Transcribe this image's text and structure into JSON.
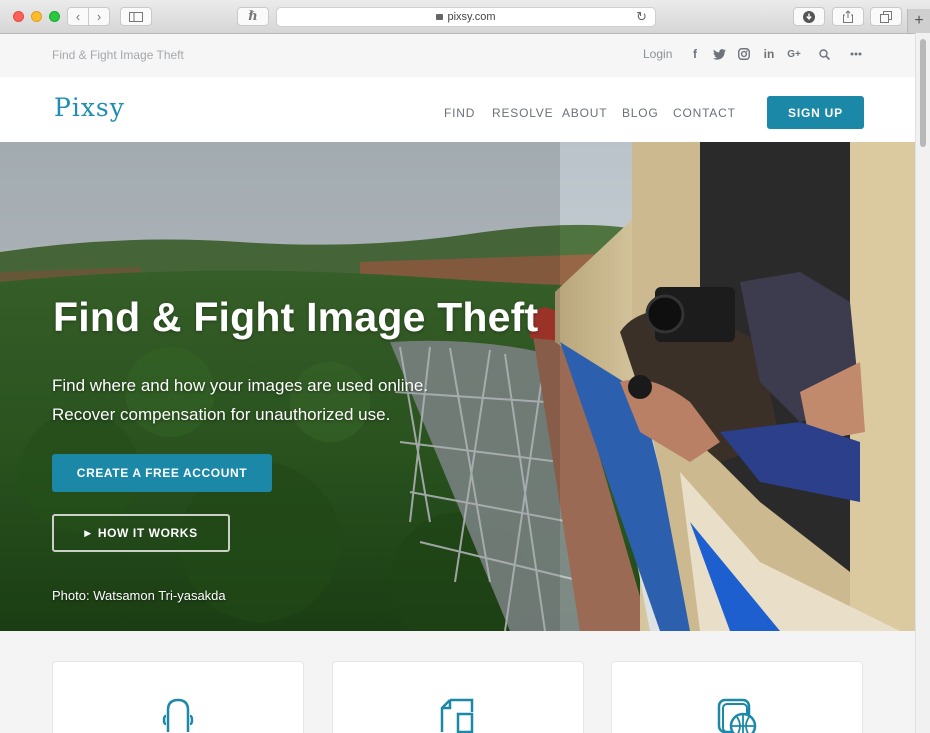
{
  "browser": {
    "url": "pixsy.com"
  },
  "topbar": {
    "tagline": "Find & Fight Image Theft",
    "login": "Login",
    "social": [
      {
        "icon": "facebook-icon",
        "glyph": "f"
      },
      {
        "icon": "twitter-icon",
        "glyph": "t"
      },
      {
        "icon": "instagram-icon",
        "glyph": "ig"
      },
      {
        "icon": "linkedin-icon",
        "glyph": "in"
      },
      {
        "icon": "google-plus-icon",
        "glyph": "G+"
      }
    ]
  },
  "navbar": {
    "logo": "Pixsy",
    "items": [
      "FIND",
      "RESOLVE",
      "ABOUT",
      "BLOG",
      "CONTACT"
    ],
    "signup": "SIGN UP"
  },
  "hero": {
    "title": "Find & Fight Image Theft",
    "subtitle_line1": "Find where and how your images are used online.",
    "subtitle_line2": "Recover compensation for unauthorized use.",
    "cta": "CREATE A FREE ACCOUNT",
    "how": "HOW IT WORKS",
    "credit": "Photo: Watsamon Tri-yasakda"
  },
  "cards": [
    {
      "icon": "user-icon"
    },
    {
      "icon": "document-icon"
    },
    {
      "icon": "globe-icon"
    }
  ],
  "colors": {
    "accent": "#1b88a8",
    "logo": "#1e8fb0"
  }
}
